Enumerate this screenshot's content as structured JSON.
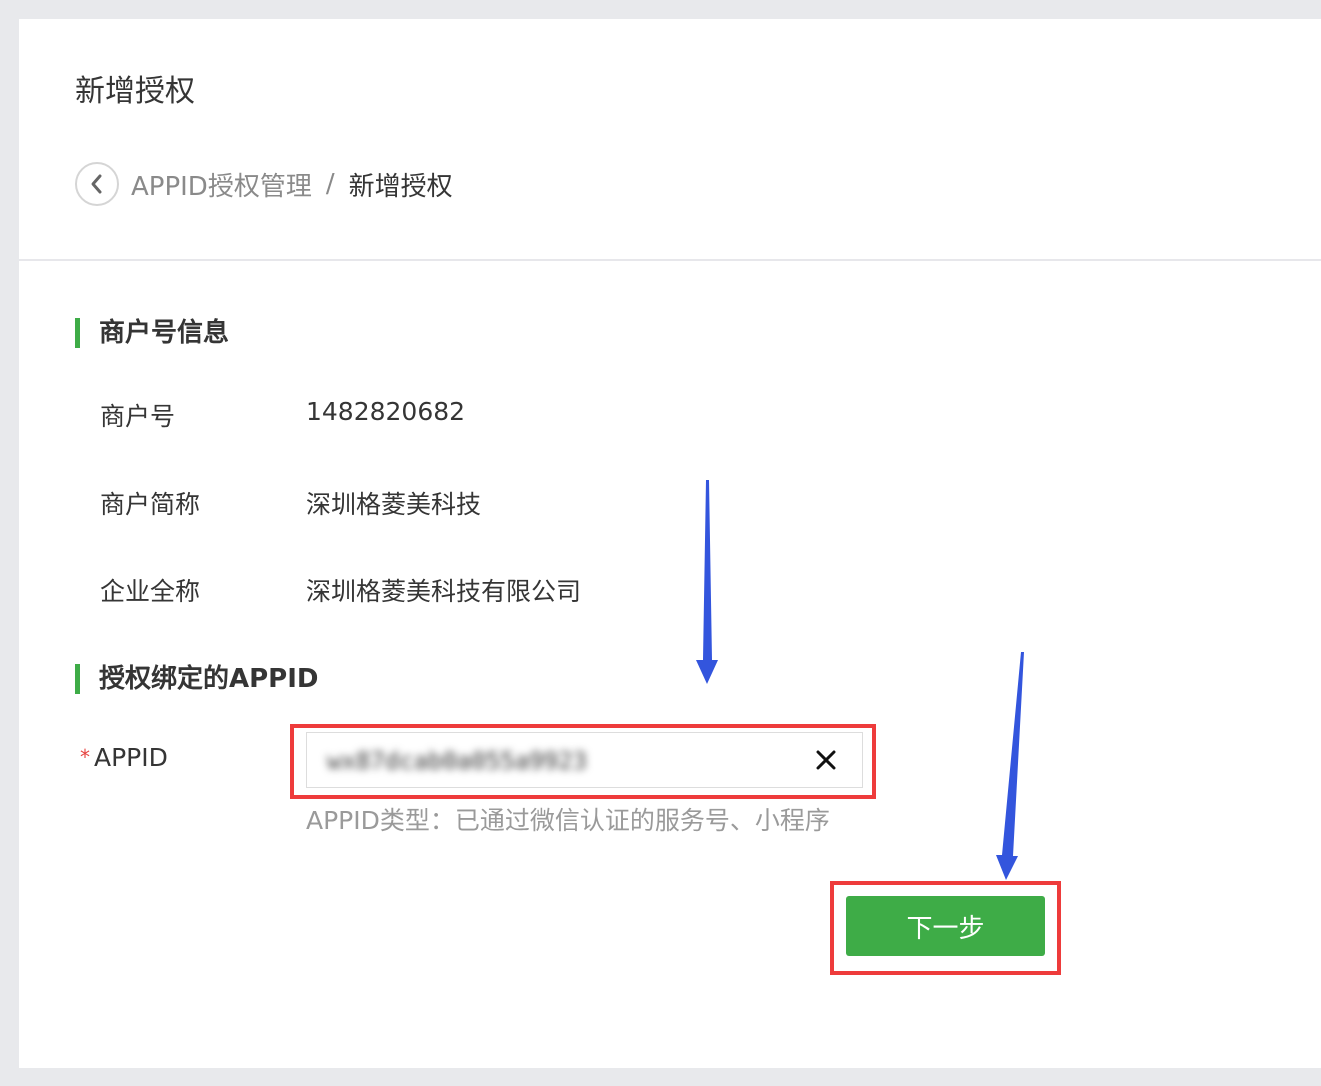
{
  "page": {
    "title": "新增授权"
  },
  "breadcrumb": {
    "back_icon": "chevron-left-icon",
    "parent": "APPID授权管理",
    "separator": "/",
    "current": "新增授权"
  },
  "merchant_section": {
    "title": "商户号信息",
    "rows": [
      {
        "label": "商户号",
        "value": "1482820682"
      },
      {
        "label": "商户简称",
        "value": "深圳格菱美科技"
      },
      {
        "label": "企业全称",
        "value": "深圳格菱美科技有限公司"
      }
    ]
  },
  "appid_section": {
    "title": "授权绑定的APPID",
    "required_mark": "*",
    "label": "APPID",
    "input_value": "wx87dcab0a055a9923",
    "clear_icon": "close-icon",
    "hint": "APPID类型：已通过微信认证的服务号、小程序"
  },
  "actions": {
    "next_label": "下一步"
  },
  "colors": {
    "accent_green": "#3eac47",
    "highlight_red": "#ee3b3b",
    "annotation_arrow": "#3355dd"
  }
}
